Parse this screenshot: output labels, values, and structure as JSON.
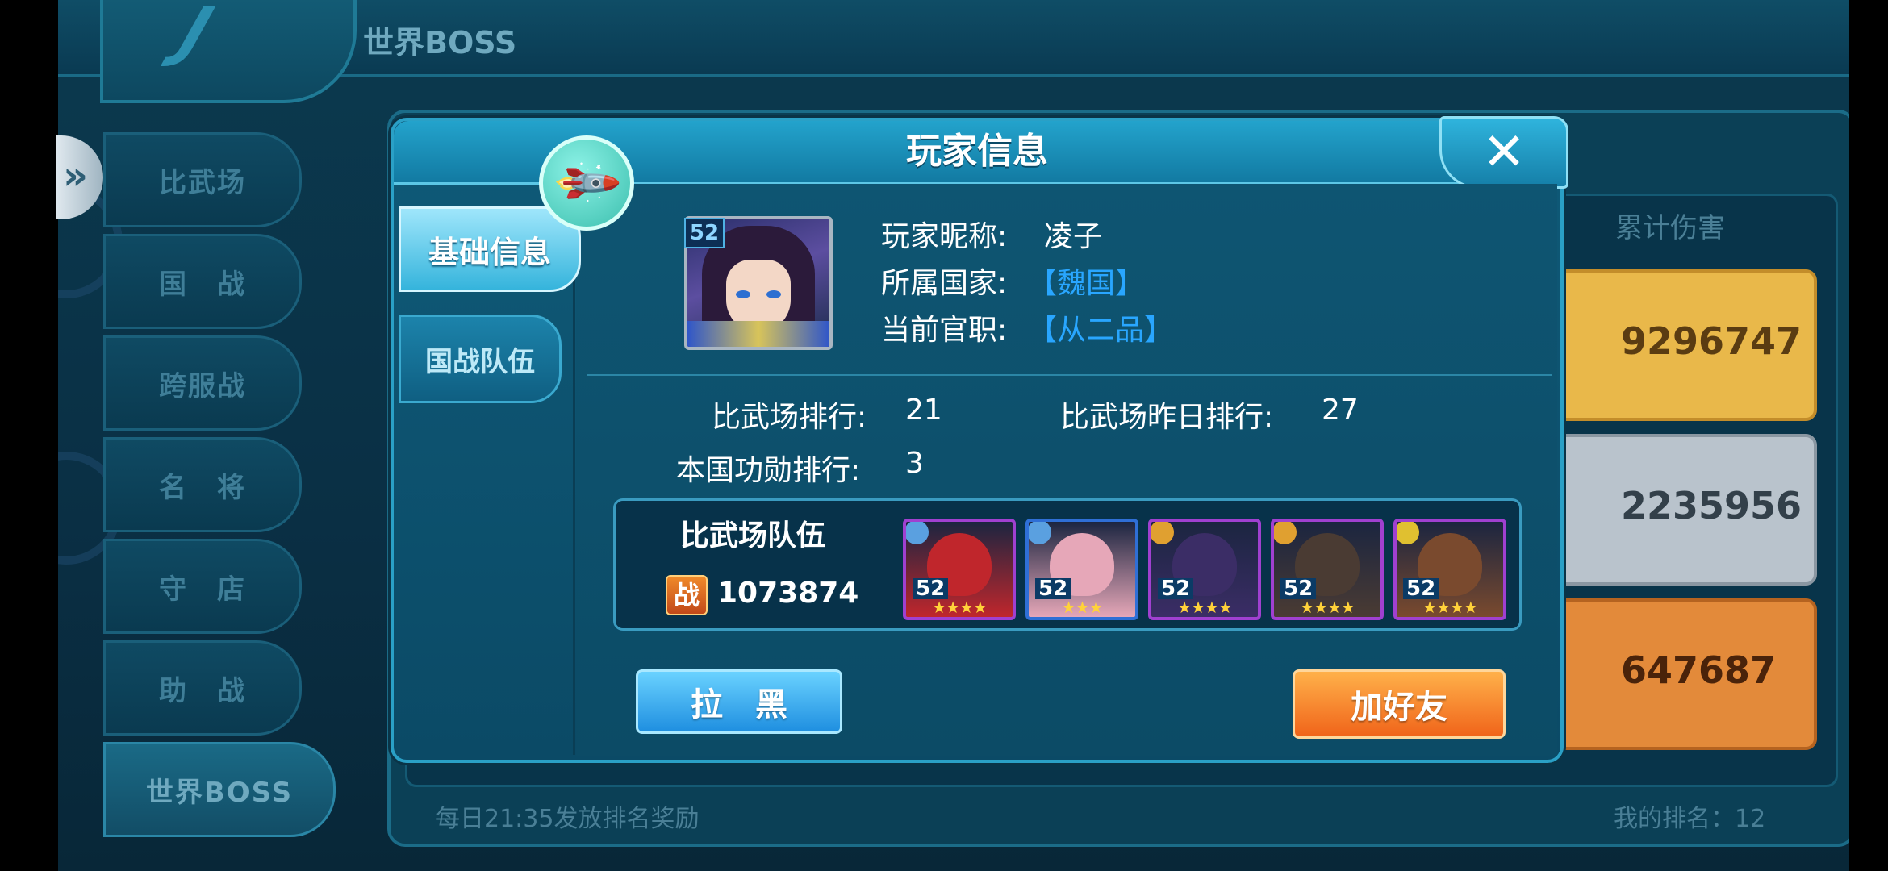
{
  "page": {
    "title": "世界BOSS",
    "side_menu": [
      "比武场",
      "国　战",
      "跨服战",
      "名　将",
      "守　店",
      "助　战",
      "世界BOSS"
    ],
    "column_header": "累计伤害",
    "rows": [
      {
        "value": "9296747",
        "color": "#e9b84a"
      },
      {
        "value": "2235956",
        "color": "#b9c3cc"
      },
      {
        "value": "647687",
        "color": "#e38a3a"
      }
    ],
    "footer_left": "每日21:35发放排名奖励",
    "footer_right": "我的排名：12"
  },
  "dialog": {
    "title": "玩家信息",
    "close_icon": "close-icon",
    "tabs": [
      "基础信息",
      "国战队伍"
    ],
    "avatar_level": "52",
    "nickname_label": "玩家昵称:",
    "nickname": "凌子",
    "country_label": "所属国家:",
    "country": "【魏国】",
    "rank_label": "当前官职:",
    "rank": "【从二品】",
    "arena_rank_label": "比武场排行:",
    "arena_rank": "21",
    "arena_yesterday_label": "比武场昨日排行:",
    "arena_yesterday": "27",
    "merit_rank_label": "本国功勋排行:",
    "merit_rank": "3",
    "team": {
      "title": "比武场队伍",
      "power_icon_label": "战",
      "power": "1073874",
      "heroes": [
        {
          "level": "52",
          "stars": "★★★★",
          "color": "#c0262c",
          "border": "#a040d0"
        },
        {
          "level": "52",
          "stars": "★★★",
          "color": "#e6a7b8",
          "border": "#2f6fd6"
        },
        {
          "level": "52",
          "stars": "★★★★",
          "color": "#3b2d66",
          "border": "#a040d0"
        },
        {
          "level": "52",
          "stars": "★★★★",
          "color": "#4a3b33",
          "border": "#a040d0"
        },
        {
          "level": "52",
          "stars": "★★★★",
          "color": "#7a4a2e",
          "border": "#a040d0"
        }
      ]
    },
    "btn_block": "拉黑",
    "btn_friend": "加好友"
  }
}
